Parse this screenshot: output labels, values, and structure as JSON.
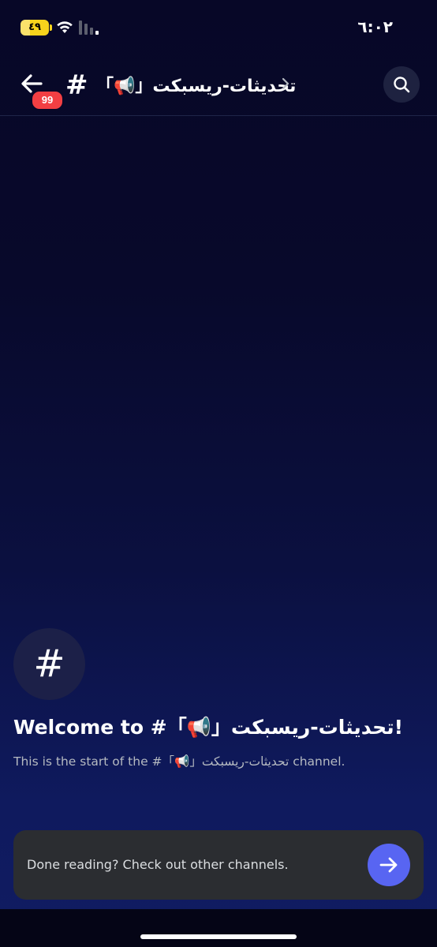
{
  "status_bar": {
    "battery": "٤٩",
    "time": "٦:٠٢"
  },
  "header": {
    "unread_badge": "99",
    "hash": "#",
    "channel_name": "「📢」تحديثات-ريسبكت",
    "icons": {
      "back": "arrow-left-icon",
      "chevron": "chevron-right-icon",
      "search": "search-icon"
    }
  },
  "welcome": {
    "hash_symbol": "#",
    "title": "Welcome to #「📢」تحديثات-ريسبكت!",
    "subtitle": "This is the start of the #「📢」تحديثات-ريسبكت channel."
  },
  "done_card": {
    "text": "Done reading? Check out other channels.",
    "button_icon": "arrow-right-icon"
  },
  "colors": {
    "accent": "#5865f2",
    "badge": "#f23f43",
    "battery": "#f7d31c",
    "card": "#2b2d31"
  }
}
